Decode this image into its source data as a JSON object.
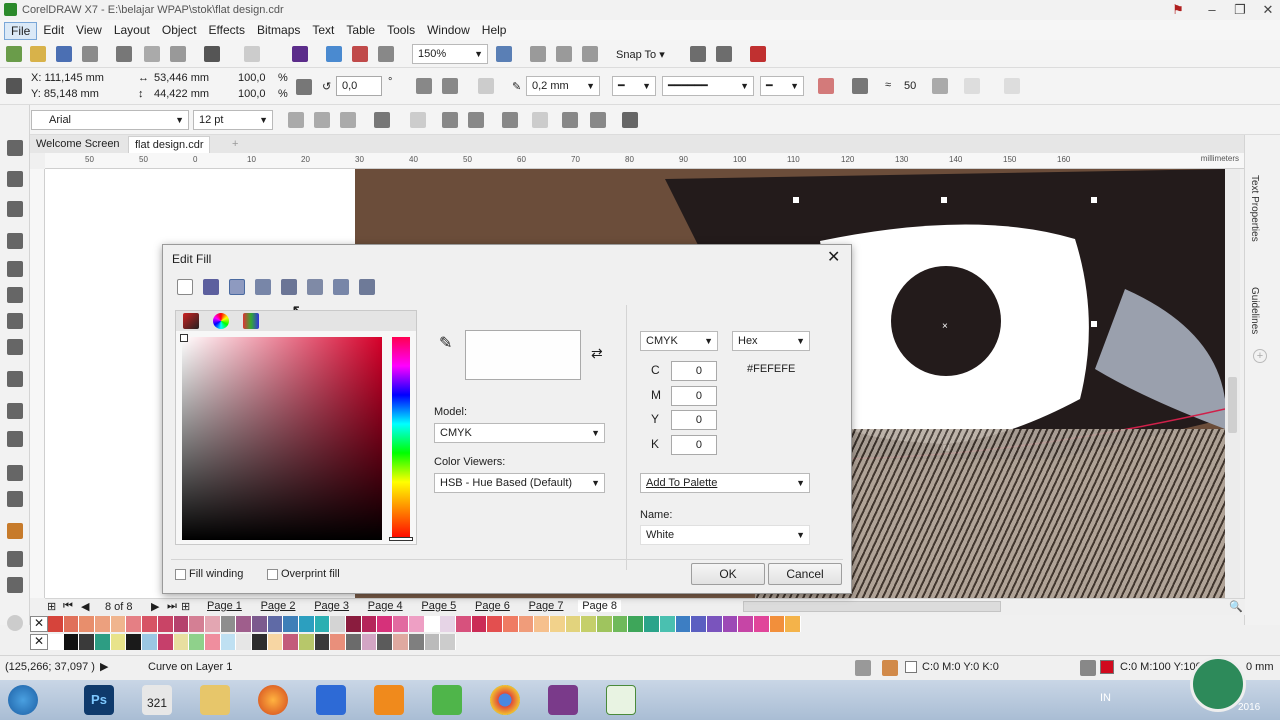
{
  "app": {
    "title": "CorelDRAW X7 - E:\\belajar WPAP\\stok\\flat design.cdr"
  },
  "menu": [
    "File",
    "Edit",
    "View",
    "Layout",
    "Object",
    "Effects",
    "Bitmaps",
    "Text",
    "Table",
    "Tools",
    "Window",
    "Help"
  ],
  "toolbar": {
    "zoom": "150%",
    "snap_to": "Snap To"
  },
  "props": {
    "x": "X: 111,145 mm",
    "y": "Y: 85,148 mm",
    "w": "53,446 mm",
    "h": "44,422 mm",
    "sx": "100,0",
    "sy": "100,0",
    "pct": "%",
    "angle": "0,0",
    "deg": "°",
    "outline": "0,2 mm",
    "smooth": "50"
  },
  "text_toolbar": {
    "font": "Arial",
    "size": "12 pt"
  },
  "tabs": {
    "welcome": "Welcome Screen",
    "doc": "flat design.cdr",
    "add": "+"
  },
  "ruler": {
    "labels": [
      "50",
      "50",
      "0",
      "10",
      "20",
      "30",
      "40",
      "50",
      "60",
      "70",
      "80",
      "90",
      "100",
      "110",
      "120",
      "130",
      "140",
      "150",
      "160"
    ],
    "unit": "millimeters"
  },
  "dock": {
    "text_properties": "Text Properties",
    "guidelines": "Guidelines"
  },
  "pages": {
    "counter": "8 of 8",
    "list": [
      "Page 1",
      "Page 2",
      "Page 3",
      "Page 4",
      "Page 5",
      "Page 6",
      "Page 7",
      "Page 8"
    ],
    "active": "Page 8"
  },
  "palette": {
    "row1": [
      "#d6443b",
      "#e0705a",
      "#e88e6c",
      "#eca07e",
      "#f0b58e",
      "#e57f84",
      "#d75465",
      "#c94466",
      "#b5426d",
      "#d47f94",
      "#e3a6b2",
      "#8e8e8e",
      "#9f5e8c",
      "#7c5a8e",
      "#5f6aa6",
      "#3e7fb8",
      "#2c9fbf",
      "#2bafb2",
      "#d4d4d4",
      "#8a1c3e",
      "#b5255a",
      "#d6317a",
      "#e26aa0",
      "#ee9fc4",
      "#ffffff",
      "#e6d4e6",
      "#d7517d",
      "#cb2c56",
      "#e34f4f",
      "#ef7b63",
      "#f09c7a",
      "#f6c08d",
      "#f2d28b",
      "#e2d37d",
      "#c5cf6a",
      "#9fc45e",
      "#6fb95b",
      "#3ea65a",
      "#2ba48a",
      "#4ac0b0",
      "#3d7ec3",
      "#5b5fc1",
      "#7a54bd",
      "#9d49b6",
      "#c645a6",
      "#e1459a",
      "#f28f3b",
      "#f4b34a"
    ],
    "row2": [
      "#ffffff",
      "#111111",
      "#3a3a3a",
      "#2d9d83",
      "#e8e38a",
      "#1a1a1a",
      "#9bc7e3",
      "#c63f6b",
      "#e8dfa0",
      "#8fd18b",
      "#ef8e9e",
      "#bfe0f2",
      "#e6e6e6",
      "#2e2e2e",
      "#f7d6a3",
      "#c35b7b",
      "#b7c76a",
      "#3a3a3a",
      "#e98f7b",
      "#6b6b6b",
      "#d3a5c4",
      "#5b5b5b",
      "#dfa9a0",
      "#7f7f7f",
      "#bbbbbb",
      "#cccccc"
    ]
  },
  "status": {
    "coords": "(125,266; 37,097 )",
    "object": "Curve on Layer 1",
    "fill": "C:0 M:0 Y:0 K:0",
    "outline": "C:0 M:100 Y:100",
    "outline_tail": "0 mm"
  },
  "dialog": {
    "title": "Edit Fill",
    "model_label": "Model:",
    "model": "CMYK",
    "viewers_label": "Color Viewers:",
    "viewer": "HSB - Hue Based (Default)",
    "mode": "CMYK",
    "format": "Hex",
    "hex": "#FEFEFE",
    "cmyk": [
      {
        "k": "C",
        "v": "0"
      },
      {
        "k": "M",
        "v": "0"
      },
      {
        "k": "Y",
        "v": "0"
      },
      {
        "k": "K",
        "v": "0"
      }
    ],
    "add_palette": "Add To Palette",
    "name_label": "Name:",
    "name": "White",
    "fill_winding": "Fill winding",
    "overprint": "Overprint fill",
    "ok": "OK",
    "cancel": "Cancel"
  },
  "taskbar": {
    "lang": "IN",
    "year": "2016",
    "calendar": "321"
  }
}
